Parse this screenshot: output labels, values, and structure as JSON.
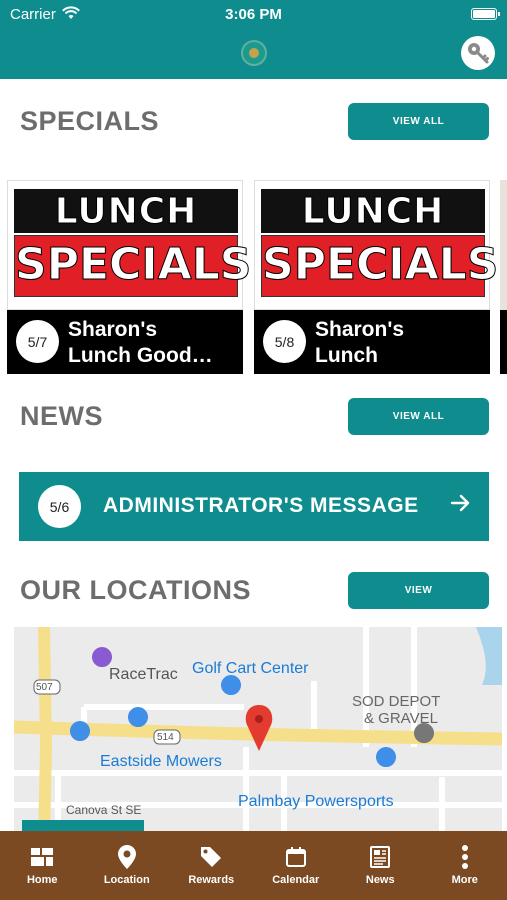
{
  "status_bar": {
    "carrier": "Carrier",
    "time": "3:06 PM"
  },
  "header": {
    "logo_icon": "app-logo",
    "account_icon": "key-icon"
  },
  "specials": {
    "title": "SPECIALS",
    "view_all": "VIEW ALL",
    "cards": [
      {
        "date": "5/7",
        "line1": "Sharon's",
        "line2": "Lunch Good…",
        "banner_top": "LUNCH",
        "banner_bottom": "SPECIALS"
      },
      {
        "date": "5/8",
        "line1": "Sharon's",
        "line2": "Lunch",
        "banner_top": "LUNCH",
        "banner_bottom": "SPECIALS"
      }
    ]
  },
  "news": {
    "title": "NEWS",
    "view_all": "VIEW ALL",
    "item": {
      "date": "5/6",
      "title": "ADMINISTRATOR'S MESSAGE"
    }
  },
  "locations": {
    "title": "OUR LOCATIONS",
    "view": "VIEW",
    "map": {
      "places": [
        "RaceTrac",
        "Golf Cart Center",
        "SOD DEPOT",
        "& GRAVEL",
        "Eastside Mowers",
        "Palmbay Powersports"
      ],
      "roads": [
        "507",
        "514",
        "Canova St SE"
      ]
    }
  },
  "bottom_nav": [
    {
      "label": "Home",
      "icon": "home-grid-icon"
    },
    {
      "label": "Location",
      "icon": "location-pin-icon"
    },
    {
      "label": "Rewards",
      "icon": "tag-icon"
    },
    {
      "label": "Calendar",
      "icon": "calendar-icon"
    },
    {
      "label": "News",
      "icon": "newspaper-icon"
    },
    {
      "label": "More",
      "icon": "more-vertical-icon"
    }
  ],
  "colors": {
    "primary": "#0e8c8e",
    "nav": "#7b4a22",
    "title_gray": "#6d6d6d"
  }
}
